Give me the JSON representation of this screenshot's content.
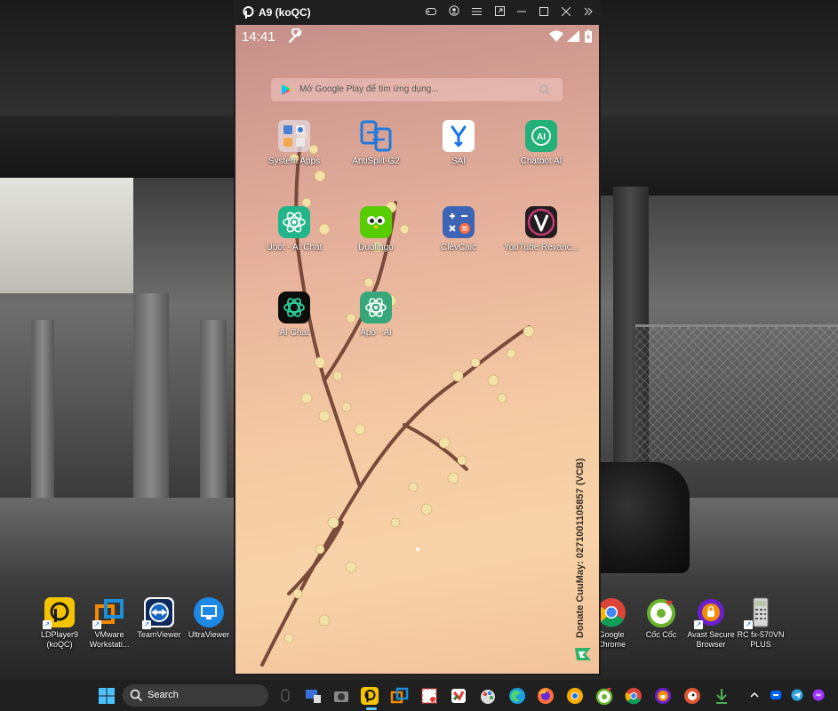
{
  "emulator": {
    "title": "A9 (koQC)",
    "titlebar_icons": [
      "gamepad-icon",
      "account-icon",
      "menu-icon",
      "popout-icon",
      "minimize-icon",
      "maximize-icon",
      "close-icon",
      "expand-sidebar-icon"
    ]
  },
  "android": {
    "status": {
      "time": "14:41"
    },
    "search": {
      "placeholder": "Mở Google Play để tìm ứng dụng..."
    },
    "apps": [
      {
        "name": "System Apps"
      },
      {
        "name": "AntiSplit-G2"
      },
      {
        "name": "SAI"
      },
      {
        "name": "Chatbot AI"
      },
      {
        "name": "Ubot - AI Chat"
      },
      {
        "name": "Duolingo"
      },
      {
        "name": "ClevCalc"
      },
      {
        "name": "YouTube Revanc..."
      },
      {
        "name": "AI Chat"
      },
      {
        "name": "Apo - AI"
      }
    ],
    "donate_text": "Donate CuuMay: 0271001105857 (VCB)"
  },
  "desktop": {
    "icons_left": [
      {
        "label": "LDPlayer9 (koQC)"
      },
      {
        "label": "VMware Workstati..."
      },
      {
        "label": "TeamViewer"
      },
      {
        "label": "UltraViewer"
      }
    ],
    "icons_right": [
      {
        "label": "Google Chrome"
      },
      {
        "label": "Cốc Cốc"
      },
      {
        "label": "Avast Secure Browser"
      },
      {
        "label": "RC fx-570VN PLUS"
      }
    ]
  },
  "taskbar": {
    "search_label": "Search"
  },
  "colors": {
    "taskbar_bg": "#202020",
    "accent": "#60cdff",
    "emulator_titlebar": "#1f1f1f"
  }
}
